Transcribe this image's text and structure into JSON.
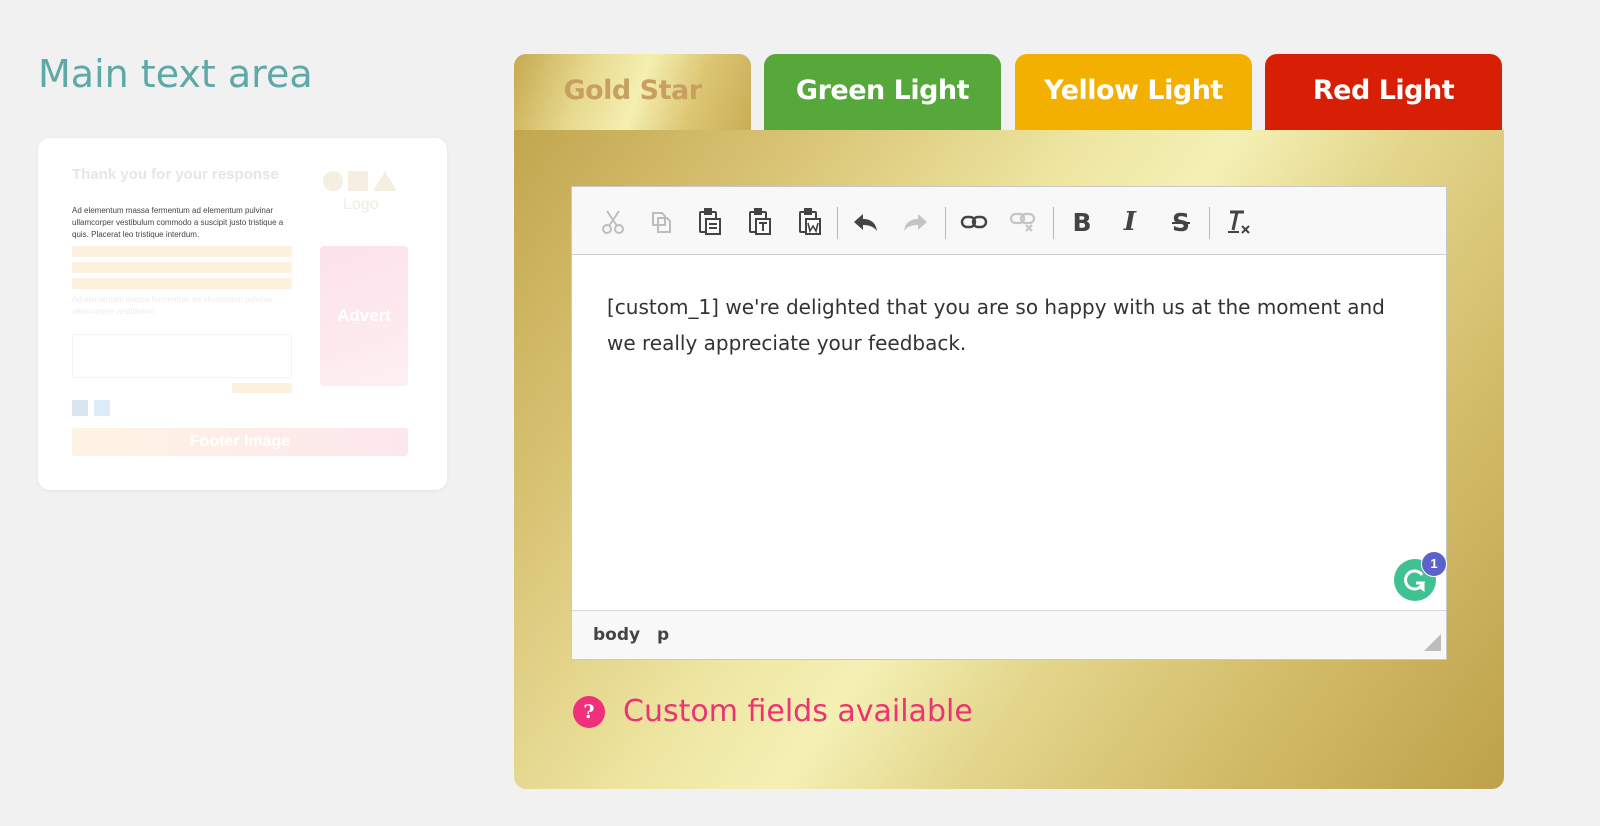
{
  "page": {
    "title": "Main text area"
  },
  "preview": {
    "title": "Thank you for your response",
    "subtitle": "",
    "body": "Ad elementum massa fermentum ad elementum pulvinar ullamcorper vestibulum commodo a suscipit justo tristique a quis. Placerat leo tristique interdum.",
    "foot_text": "Ad elementum massa fermentum ad elementum pulvinar ullamcorper vestibulum.",
    "logo": "Logo",
    "advert": "Advert",
    "footer_image": "Footer Image"
  },
  "tabs": [
    {
      "label": "Gold Star",
      "active": true
    },
    {
      "label": "Green Light",
      "color": "#55a839"
    },
    {
      "label": "Yellow Light",
      "color": "#f3b000"
    },
    {
      "label": "Red Light",
      "color": "#d81e04"
    }
  ],
  "editor": {
    "toolbar": [
      "cut-icon",
      "copy-icon",
      "paste-icon",
      "paste-text-icon",
      "paste-word-icon",
      "undo-icon",
      "redo-icon",
      "link-icon",
      "unlink-icon",
      "bold-icon",
      "italic-icon",
      "strikethrough-icon",
      "remove-format-icon"
    ],
    "content": "[custom_1] we're delighted that you are so happy with us at the moment and we really appreciate your feedback.",
    "status_path": [
      "body",
      "p"
    ],
    "grammarly_count": "1"
  },
  "help": {
    "icon": "?",
    "label": "Custom fields available"
  },
  "colors": {
    "accent_teal": "#5fa8a8",
    "help_pink": "#ec3373",
    "grammarly": "#3fc191"
  }
}
